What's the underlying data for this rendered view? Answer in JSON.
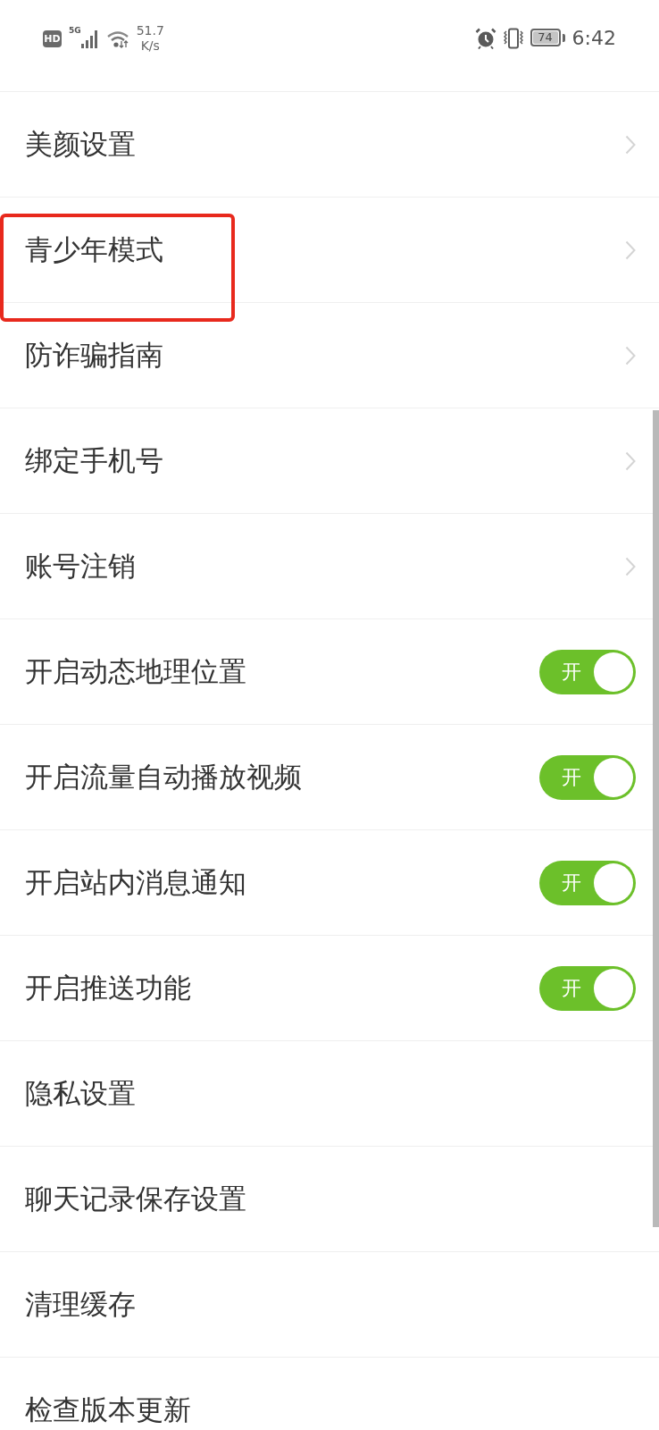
{
  "status_bar": {
    "hd": "HD",
    "network": "5G",
    "speed_value": "51.7",
    "speed_unit": "K/s",
    "battery": "74",
    "time": "6:42"
  },
  "items": [
    {
      "kind": "link",
      "label": "美颜设置",
      "highlighted": false
    },
    {
      "kind": "link",
      "label": "青少年模式",
      "highlighted": true
    },
    {
      "kind": "link",
      "label": "防诈骗指南",
      "highlighted": false
    },
    {
      "kind": "link",
      "label": "绑定手机号",
      "highlighted": false
    },
    {
      "kind": "link",
      "label": "账号注销",
      "highlighted": false
    },
    {
      "kind": "toggle",
      "label": "开启动态地理位置",
      "on": true,
      "switch_label": "开",
      "highlighted": false
    },
    {
      "kind": "toggle",
      "label": "开启流量自动播放视频",
      "on": true,
      "switch_label": "开",
      "highlighted": false
    },
    {
      "kind": "toggle",
      "label": "开启站内消息通知",
      "on": true,
      "switch_label": "开",
      "highlighted": false
    },
    {
      "kind": "toggle",
      "label": "开启推送功能",
      "on": true,
      "switch_label": "开",
      "highlighted": false
    },
    {
      "kind": "plain",
      "label": "隐私设置",
      "highlighted": false
    },
    {
      "kind": "plain",
      "label": "聊天记录保存设置",
      "highlighted": false
    },
    {
      "kind": "plain",
      "label": "清理缓存",
      "highlighted": false
    },
    {
      "kind": "plain",
      "label": "检查版本更新",
      "highlighted": false
    }
  ]
}
